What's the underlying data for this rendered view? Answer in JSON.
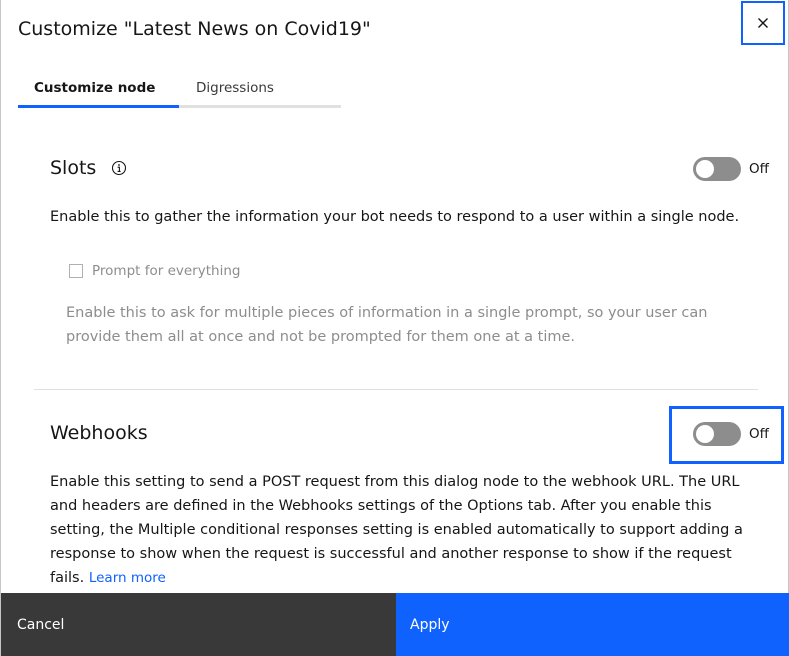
{
  "dialog": {
    "title": "Customize \"Latest News on Covid19\"",
    "close_icon": "close-icon"
  },
  "tabs": [
    {
      "label": "Customize node",
      "active": true
    },
    {
      "label": "Digressions",
      "active": false
    }
  ],
  "slots": {
    "title": "Slots",
    "info_icon": "information-icon",
    "toggle_state": "Off",
    "description": "Enable this to gather the information your bot needs to respond to a user within a single node.",
    "prompt_checkbox": {
      "label": "Prompt for everything",
      "checked": false,
      "disabled": true
    },
    "prompt_description": "Enable this to ask for multiple pieces of information in a single prompt, so your user can provide them all at once and not be prompted for them one at a time."
  },
  "webhooks": {
    "title": "Webhooks",
    "toggle_state": "Off",
    "description": "Enable this setting to send a POST request from this dialog node to the webhook URL. The URL and headers are defined in the Webhooks settings of the Options tab. After you enable this setting, the Multiple conditional responses setting is enabled automatically to support adding a response to show when the request is successful and another response to show if the request fails.",
    "learn_more": "Learn more"
  },
  "footer": {
    "cancel_label": "Cancel",
    "apply_label": "Apply"
  },
  "colors": {
    "accent": "#0f62fe",
    "secondary_button": "#393939",
    "toggle_off": "#8d8d8d"
  }
}
